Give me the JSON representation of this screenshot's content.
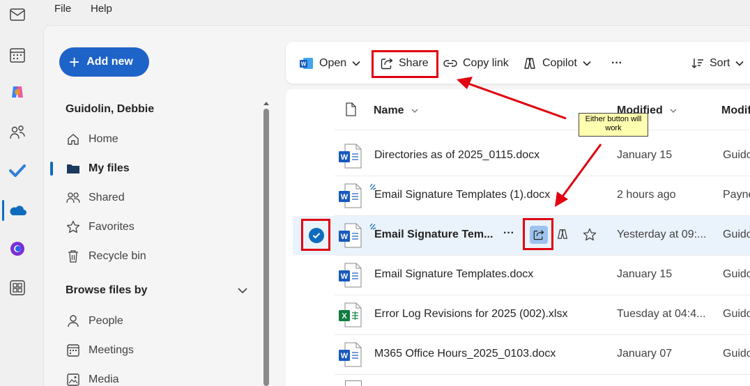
{
  "menu": {
    "file": "File",
    "help": "Help"
  },
  "rail": [
    "mail-icon",
    "calendar-icon",
    "copilot-icon",
    "people-icon",
    "todo-icon",
    "onedrive-icon",
    "loop-icon",
    "apps-icon"
  ],
  "add_new": "Add new",
  "nav": {
    "user": "Guidolin, Debbie",
    "items": [
      {
        "label": "Home",
        "icon": "home-icon"
      },
      {
        "label": "My files",
        "icon": "folder-icon"
      },
      {
        "label": "Shared",
        "icon": "shared-icon"
      },
      {
        "label": "Favorites",
        "icon": "star-icon"
      },
      {
        "label": "Recycle bin",
        "icon": "trash-icon"
      }
    ],
    "browse_header": "Browse files by",
    "browse_items": [
      {
        "label": "People",
        "icon": "person-icon"
      },
      {
        "label": "Meetings",
        "icon": "meetings-icon"
      },
      {
        "label": "Media",
        "icon": "media-icon"
      }
    ]
  },
  "commands": {
    "open": "Open",
    "share": "Share",
    "copy_link": "Copy link",
    "copilot": "Copilot",
    "more": "···",
    "sort": "Sort"
  },
  "columns": {
    "name": "Name",
    "modified": "Modified",
    "modified_by": "Modif"
  },
  "files": [
    {
      "name": "Directories as of 2025_0115.docx",
      "modified": "January 15",
      "modified_by": "Guido",
      "type": "word",
      "new": false,
      "selected": false
    },
    {
      "name": "Email Signature Templates (1).docx",
      "modified": "2 hours ago",
      "modified_by": "Payne",
      "type": "word",
      "new": true,
      "selected": false
    },
    {
      "name": "Email Signature Tem...",
      "modified": "Yesterday at 09:...",
      "modified_by": "Guido",
      "type": "word",
      "new": true,
      "selected": true
    },
    {
      "name": "Email Signature Templates.docx",
      "modified": "January 15",
      "modified_by": "Guido",
      "type": "word",
      "new": false,
      "selected": false
    },
    {
      "name": "Error Log Revisions for 2025 (002).xlsx",
      "modified": "Tuesday at 04:4...",
      "modified_by": "Guido",
      "type": "excel",
      "new": false,
      "selected": false
    },
    {
      "name": "M365 Office Hours_2025_0103.docx",
      "modified": "January 07",
      "modified_by": "Guido",
      "type": "word",
      "new": false,
      "selected": false
    }
  ],
  "row_more": "···",
  "callout": "Either button will work",
  "colors": {
    "accent": "#0f6cbd",
    "annotation_red": "#e0000f",
    "callout_bg": "#ffffb0",
    "selected_row": "#eaf2fb",
    "word_blue": "#185abd",
    "excel_green": "#107c41"
  }
}
